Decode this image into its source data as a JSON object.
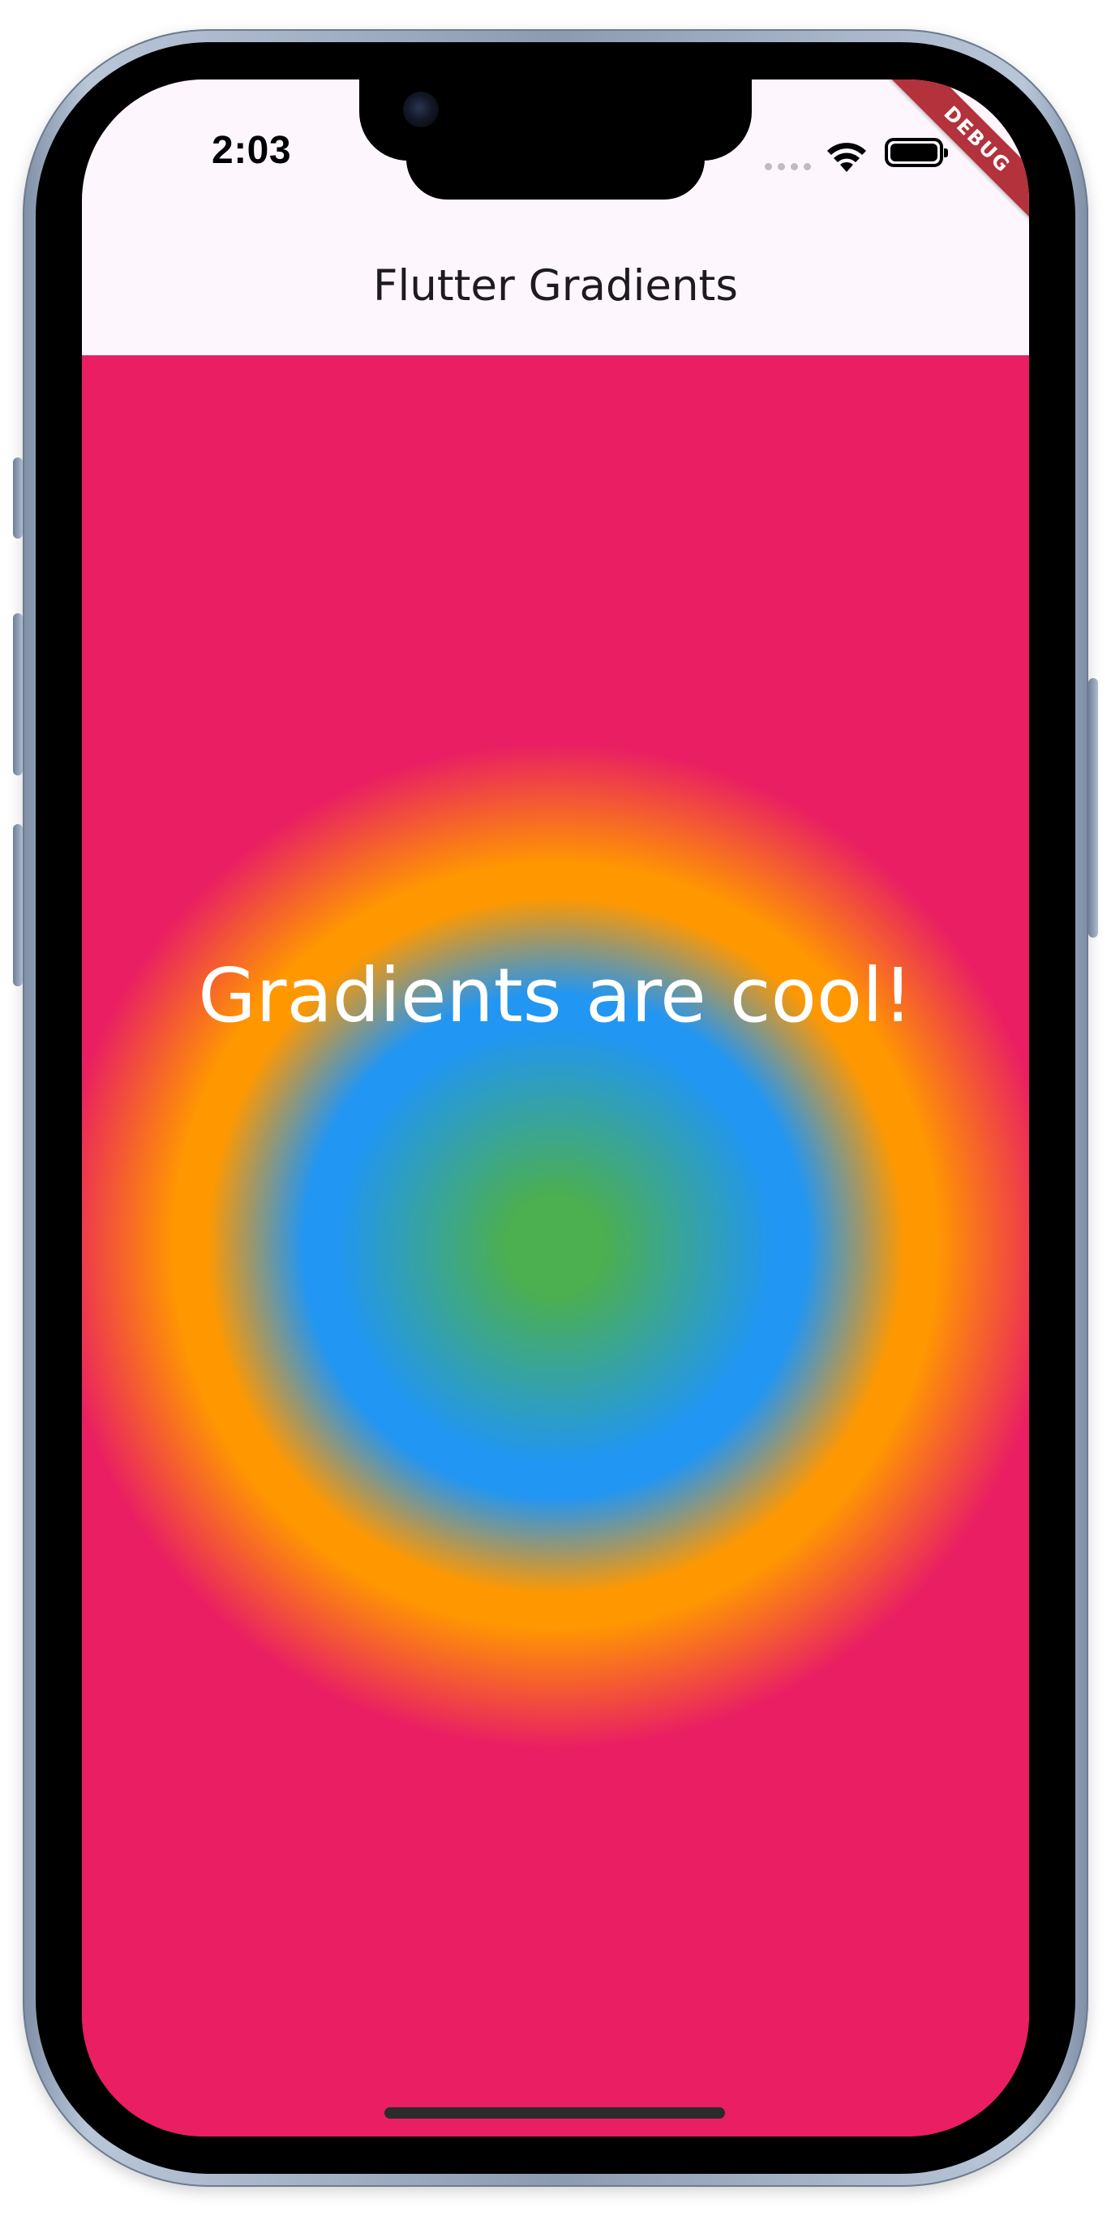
{
  "status_bar": {
    "time": "2:03"
  },
  "app_bar": {
    "title": "Flutter Gradients"
  },
  "debug_banner": {
    "label": "DEBUG"
  },
  "body": {
    "text": "Gradients are cool!",
    "gradient_colors": [
      "#4caf50",
      "#2196f3",
      "#ff9800",
      "#e91e63"
    ]
  },
  "colors": {
    "app_bar_background": "#fdf7fd",
    "debug_banner": "#b3323c",
    "body_text": "#ffffff"
  },
  "icons": {
    "signal": "cellular-signal-icon",
    "wifi": "wifi-icon",
    "battery": "battery-icon"
  }
}
